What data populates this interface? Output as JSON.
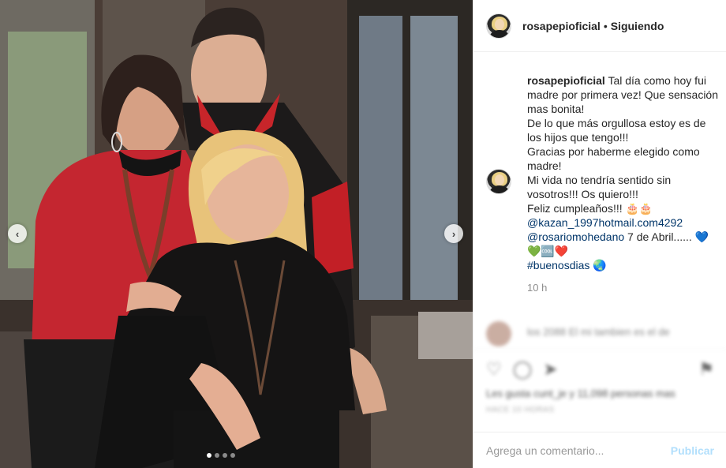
{
  "post": {
    "username": "rosapepioficial",
    "separator": "•",
    "follow_status": "Siguiendo",
    "caption_lines": [
      "Tal día como hoy fui",
      "madre por primera vez! Que sensación",
      "mas bonita!",
      "De lo que más orgullosa estoy es de",
      "los hijos que tengo!!!",
      "Gracias por haberme elegido como",
      "madre!",
      "Mi vida no tendría sentido sin",
      "vosotros!!! Os quiero!!!",
      "Feliz cumpleaños!!! 🎂🎂"
    ],
    "mention_1": "@kazan_1997hotmail.com4292",
    "mention_2": "@rosariomohedano",
    "mention_2_tail": " 7 de Abril...... 💙",
    "hearts_line": "💚🆒❤️",
    "hashtag": "#buenosdias",
    "hashtag_tail": " 🌏",
    "time_ago": "10 h",
    "blurred_comment": "los 2088 El mi tambien es el de",
    "likes_text": "Les gusta cunt_je y 11,098 personas mas",
    "date_text": "HACE 10 HORAS"
  },
  "comment_box": {
    "placeholder": "Agrega un comentario...",
    "post_label": "Publicar"
  },
  "icons": {
    "prev": "‹",
    "next": "›",
    "heart": "♡",
    "comment": "◯",
    "share": "➤",
    "bookmark": "⚑"
  },
  "carousel": {
    "slides": 4,
    "active": 1
  },
  "colors": {
    "mention": "#003569",
    "post_disabled": "#b2dffc",
    "muted": "#8e8e8e"
  }
}
